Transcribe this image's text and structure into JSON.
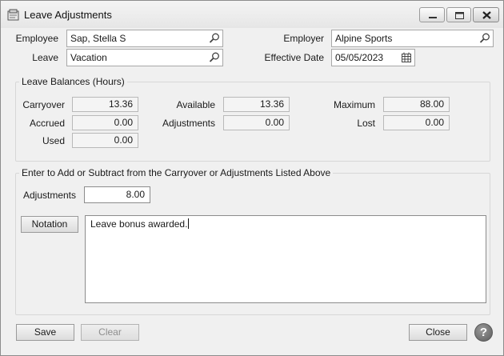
{
  "window": {
    "title": "Leave Adjustments"
  },
  "header": {
    "employee_label": "Employee",
    "employee_value": "Sap, Stella S",
    "leave_label": "Leave",
    "leave_value": "Vacation",
    "employer_label": "Employer",
    "employer_value": "Alpine Sports",
    "effective_date_label": "Effective Date",
    "effective_date_value": "05/05/2023"
  },
  "balances": {
    "group_title": "Leave Balances (Hours)",
    "carryover_label": "Carryover",
    "carryover_value": "13.36",
    "accrued_label": "Accrued",
    "accrued_value": "0.00",
    "used_label": "Used",
    "used_value": "0.00",
    "available_label": "Available",
    "available_value": "13.36",
    "adjustments_label": "Adjustments",
    "adjustments_value": "0.00",
    "maximum_label": "Maximum",
    "maximum_value": "88.00",
    "lost_label": "Lost",
    "lost_value": "0.00"
  },
  "adjust": {
    "group_title": "Enter to Add or Subtract from the Carryover or Adjustments Listed Above",
    "adjustments_label": "Adjustments",
    "adjustments_value": "8.00",
    "notation_button": "Notation",
    "notation_text": "Leave bonus awarded."
  },
  "footer": {
    "save_label": "Save",
    "clear_label": "Clear",
    "close_label": "Close",
    "help_glyph": "?"
  }
}
